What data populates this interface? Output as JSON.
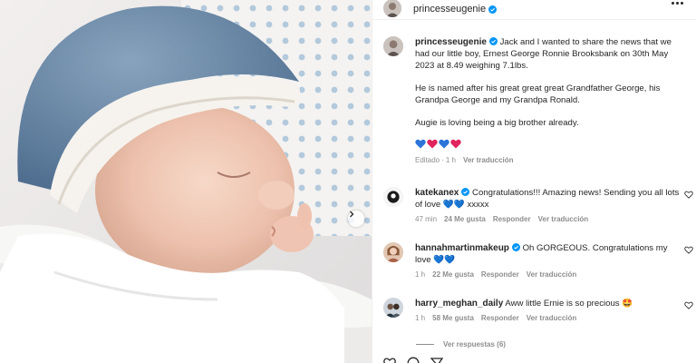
{
  "post": {
    "username": "princesseugenie",
    "more_icon": "more-horizontal-icon",
    "colors": {
      "text": "#262626",
      "muted": "#8e8e8e",
      "verified": "#0095f6",
      "like": "#262626"
    }
  },
  "caption": {
    "username": "princesseugenie",
    "text1": "Jack and I wanted to share the news that we had our little boy, Ernest George Ronnie Brooksbank on 30th May 2023 at 8.49 weighing 7.1lbs.",
    "text2": "He is named after his great great great Grandfather George, his Grandpa George and my Grandpa Ronald.",
    "text3": "Augie is loving being a big brother already.",
    "hearts": [
      "blue-heart",
      "red-heart",
      "blue-heart",
      "red-heart"
    ],
    "edited": "Editado",
    "time": "1 h",
    "translate": "Ver traducción"
  },
  "comments": [
    {
      "username": "katekanex",
      "text": "Congratulations!!! Amazing news! Sending you all lots of love 💙💙 xxxxx",
      "time": "47 min",
      "likes": "24 Me gusta",
      "reply": "Responder",
      "translate": "Ver traducción"
    },
    {
      "username": "hannahmartinmakeup",
      "text": "Oh GORGEOUS. Congratulations my love 💙💙",
      "time": "1 h",
      "likes": "22 Me gusta",
      "reply": "Responder",
      "translate": "Ver traducción"
    },
    {
      "username": "harry_meghan_daily",
      "text": "Aww little Ernie is so precious 🤩",
      "time": "1 h",
      "likes": "58 Me gusta",
      "reply": "Responder",
      "translate": "Ver traducción"
    }
  ],
  "replies_label": "Ver respuestas (6)",
  "icons": {
    "carousel": "chevron-right-icon",
    "like": "heart-outline-icon",
    "actions": [
      "heart-icon",
      "comment-icon",
      "share-icon",
      "bookmark-icon"
    ]
  }
}
